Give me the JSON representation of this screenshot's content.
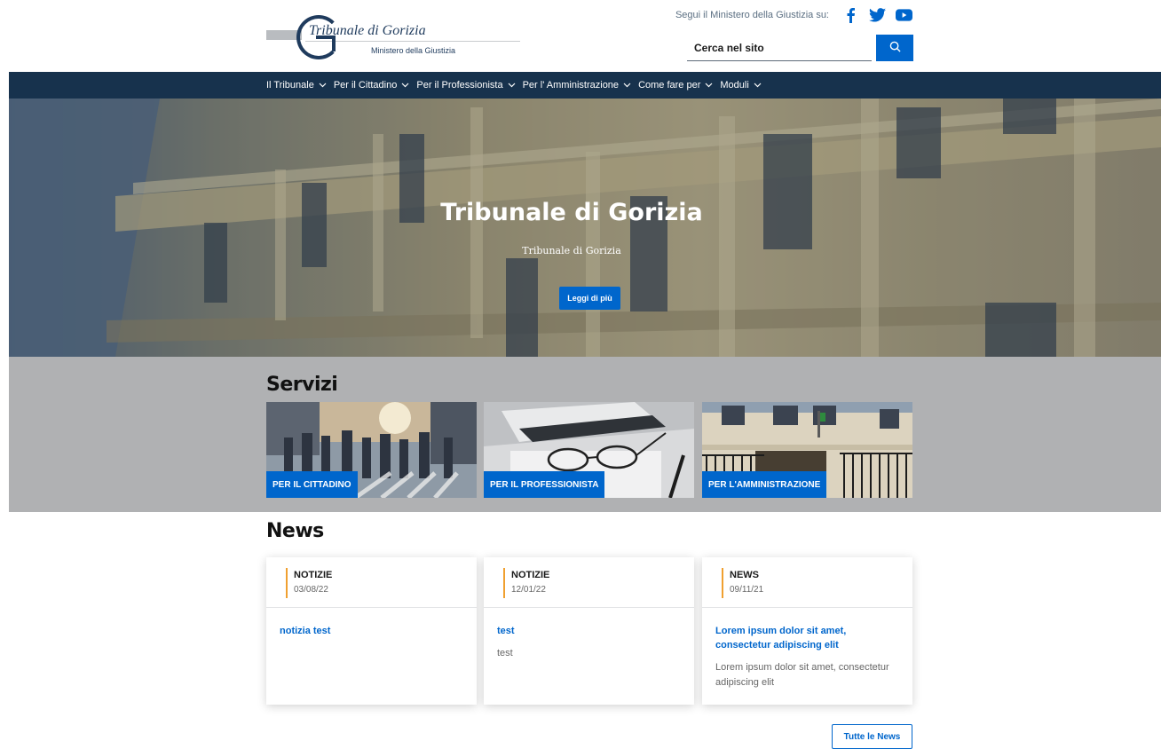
{
  "header": {
    "logo": {
      "title": "Tribunale di Gorizia",
      "subtitle": "Ministero della Giustizia"
    },
    "social_label": "Segui il Ministero della Giustizia su:",
    "social_icons": [
      "facebook-icon",
      "twitter-icon",
      "youtube-icon"
    ],
    "search": {
      "placeholder": "Cerca nel sito"
    }
  },
  "nav": {
    "items": [
      {
        "label": "Il Tribunale"
      },
      {
        "label": "Per il Cittadino"
      },
      {
        "label": "Per il Professionista"
      },
      {
        "label": "Per l' Amministrazione"
      },
      {
        "label": "Come fare per"
      },
      {
        "label": "Moduli"
      }
    ]
  },
  "hero": {
    "title": "Tribunale di Gorizia",
    "subtitle": "Tribunale di Gorizia",
    "button_label": "Leggi di più"
  },
  "servizi": {
    "title": "Servizi",
    "cards": [
      {
        "label": "PER IL CITTADINO"
      },
      {
        "label": "PER IL PROFESSIONISTA"
      },
      {
        "label": "PER L'AMMINISTRAZIONE"
      }
    ]
  },
  "news": {
    "title": "News",
    "items": [
      {
        "category": "NOTIZIE",
        "date": "03/08/22",
        "title": "notizia test",
        "body": ""
      },
      {
        "category": "NOTIZIE",
        "date": "12/01/22",
        "title": "test",
        "body": "test"
      },
      {
        "category": "NEWS",
        "date": "09/11/21",
        "title": "Lorem ipsum dolor sit amet, consectetur adipiscing elit",
        "body": "Lorem ipsum dolor sit amet, consectetur adipiscing elit"
      }
    ],
    "all_label": "Tutte le News"
  },
  "colors": {
    "primary": "#0066cc",
    "nav_bg": "#17324d",
    "servizi_bg": "#b0b1b3",
    "accent": "#f0a030"
  }
}
